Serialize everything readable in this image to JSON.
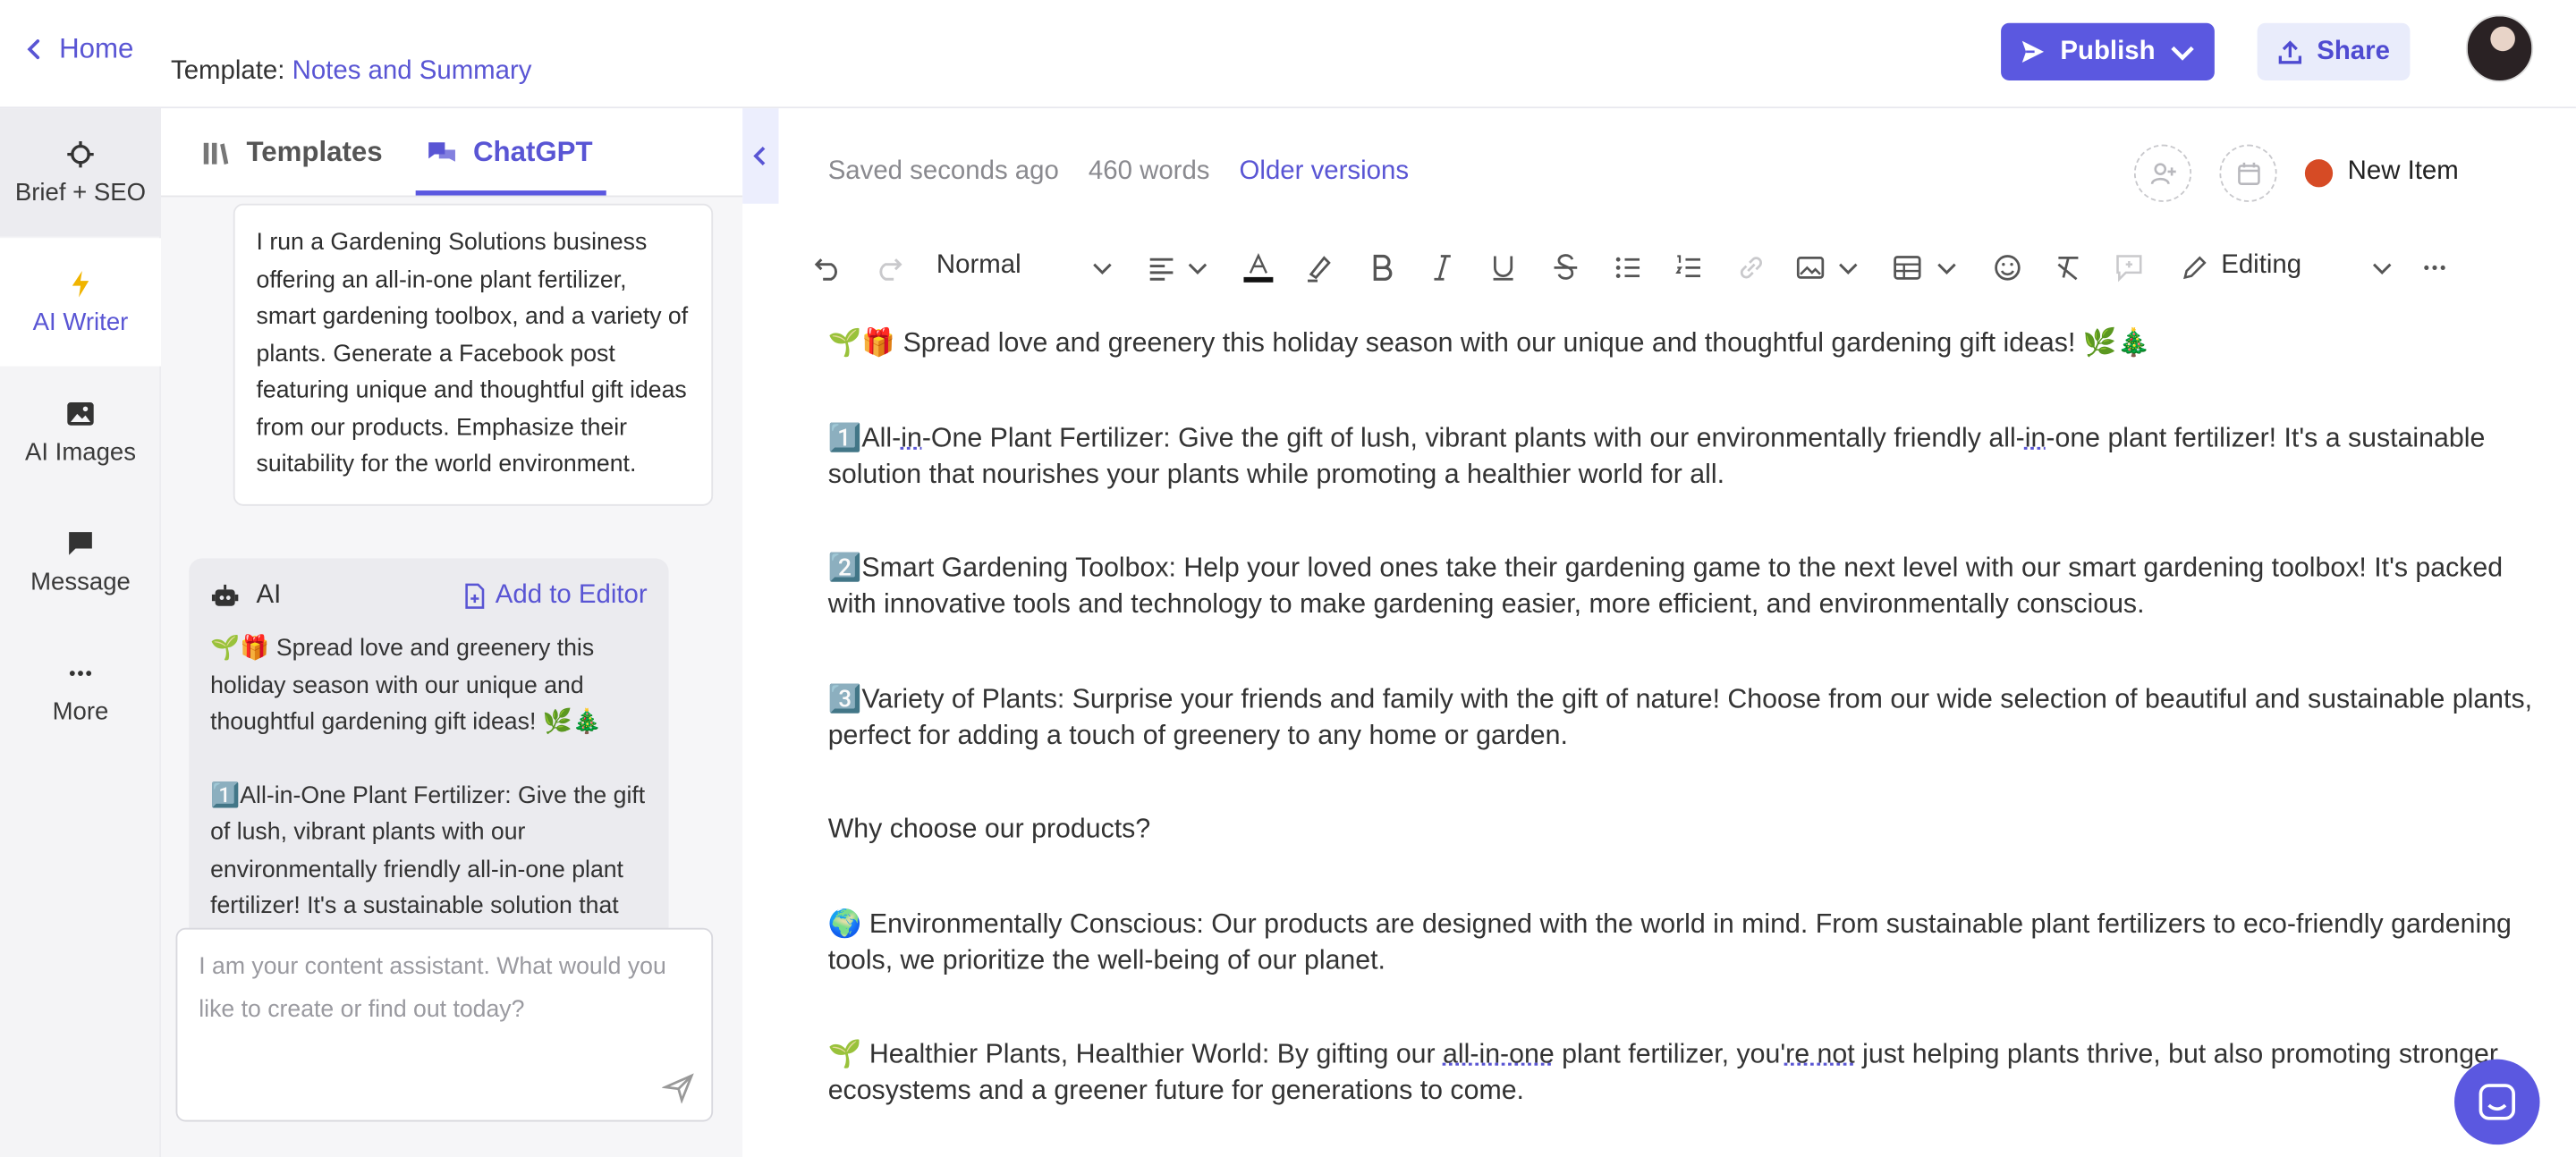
{
  "header": {
    "home_label": "Home",
    "template_prefix": "Template:",
    "template_name": "Notes and Summary",
    "publish_label": "Publish",
    "share_label": "Share"
  },
  "leftnav": {
    "items": [
      {
        "label": "Brief + SEO",
        "icon": "crosshair-icon"
      },
      {
        "label": "AI Writer",
        "icon": "lightning-icon"
      },
      {
        "label": "AI Images",
        "icon": "image-icon"
      },
      {
        "label": "Message",
        "icon": "message-icon"
      },
      {
        "label": "More",
        "icon": "more-dots-icon"
      }
    ]
  },
  "chat": {
    "tabs": [
      {
        "label": "Templates",
        "icon": "library-icon"
      },
      {
        "label": "ChatGPT",
        "icon": "chat-bubbles-icon"
      }
    ],
    "user_message": "I run a Gardening Solutions business offering an all-in-one plant fertilizer, smart gardening toolbox, and a variety of plants. Generate a Facebook post featuring unique and thoughtful gift ideas from our products. Emphasize their suitability for the world environment.",
    "ai_label": "AI",
    "add_to_editor": "Add to Editor",
    "ai_paragraphs": [
      "🌱🎁 Spread love and greenery this holiday season with our unique and thoughtful gardening gift ideas! 🌿🎄",
      "1️⃣All-in-One Plant Fertilizer: Give the gift of lush, vibrant plants with our environmentally friendly all-in-one plant fertilizer! It's a sustainable solution that"
    ],
    "input_placeholder": "I am your content assistant. What would you like to create or find out today?"
  },
  "editor": {
    "saved": "Saved seconds ago",
    "words": "460 words",
    "older_versions": "Older versions",
    "new_item": "New Item",
    "new_item_color": "#d64b25",
    "toolbar": {
      "style": "Normal",
      "mode": "Editing"
    },
    "paragraphs": {
      "p1": "🌱🎁 Spread love and greenery this holiday season with our unique and thoughtful gardening gift ideas! 🌿🎄",
      "p2a": "1️⃣All-",
      "p2b": "in",
      "p2c": "-One Plant Fertilizer: Give the gift of lush, vibrant plants with our environmentally friendly all-",
      "p2d": "in",
      "p2e": "-one plant fertilizer! It's a sustainable solution that nourishes your plants while promoting a healthier world for all.",
      "p3": "2️⃣Smart Gardening Toolbox: Help your loved ones take their gardening game to the next level with our smart gardening toolbox! It's packed with innovative tools and technology to make gardening easier, more efficient, and environmentally conscious.",
      "p4": "3️⃣Variety of Plants: Surprise your friends and family with the gift of nature! Choose from our wide selection of beautiful and sustainable plants, perfect for adding a touch of greenery to any home or garden.",
      "p5": "Why choose our products?",
      "p6": "🌍 Environmentally Conscious: Our products are designed with the world in mind. From sustainable plant fertilizers to eco-friendly gardening tools, we prioritize the well-being of our planet.",
      "p7a": "🌱 Healthier Plants, Healthier World: By gifting our ",
      "p7b": "all-in-one",
      "p7c": " plant fertilizer, you'",
      "p7d": "re not",
      "p7e": " just helping plants thrive, but also promoting stronger ecosystems and a greener future for generations to come."
    }
  },
  "colors": {
    "accent": "#5b58e0",
    "link": "#5955d4"
  }
}
